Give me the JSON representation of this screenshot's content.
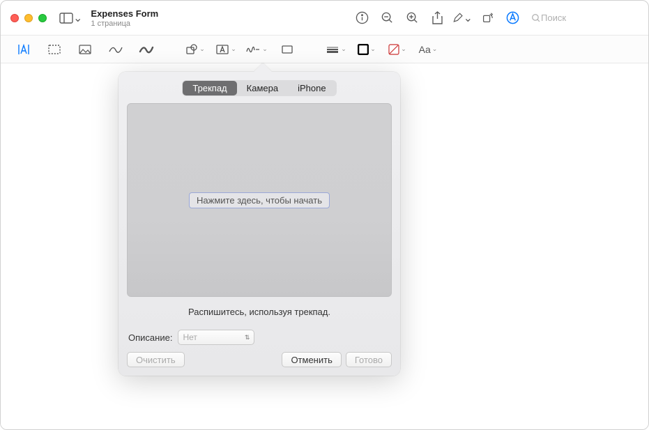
{
  "window": {
    "title": "Expenses Form",
    "subtitle": "1 страница"
  },
  "search": {
    "placeholder": "Поиск"
  },
  "popover": {
    "tabs": {
      "trackpad": "Трекпад",
      "camera": "Камера",
      "iphone": "iPhone"
    },
    "prompt": "Нажмите здесь, чтобы начать",
    "instruction": "Распишитесь, используя трекпад.",
    "description_label": "Описание:",
    "description_value": "Нет",
    "buttons": {
      "clear": "Очистить",
      "cancel": "Отменить",
      "done": "Готово"
    }
  }
}
